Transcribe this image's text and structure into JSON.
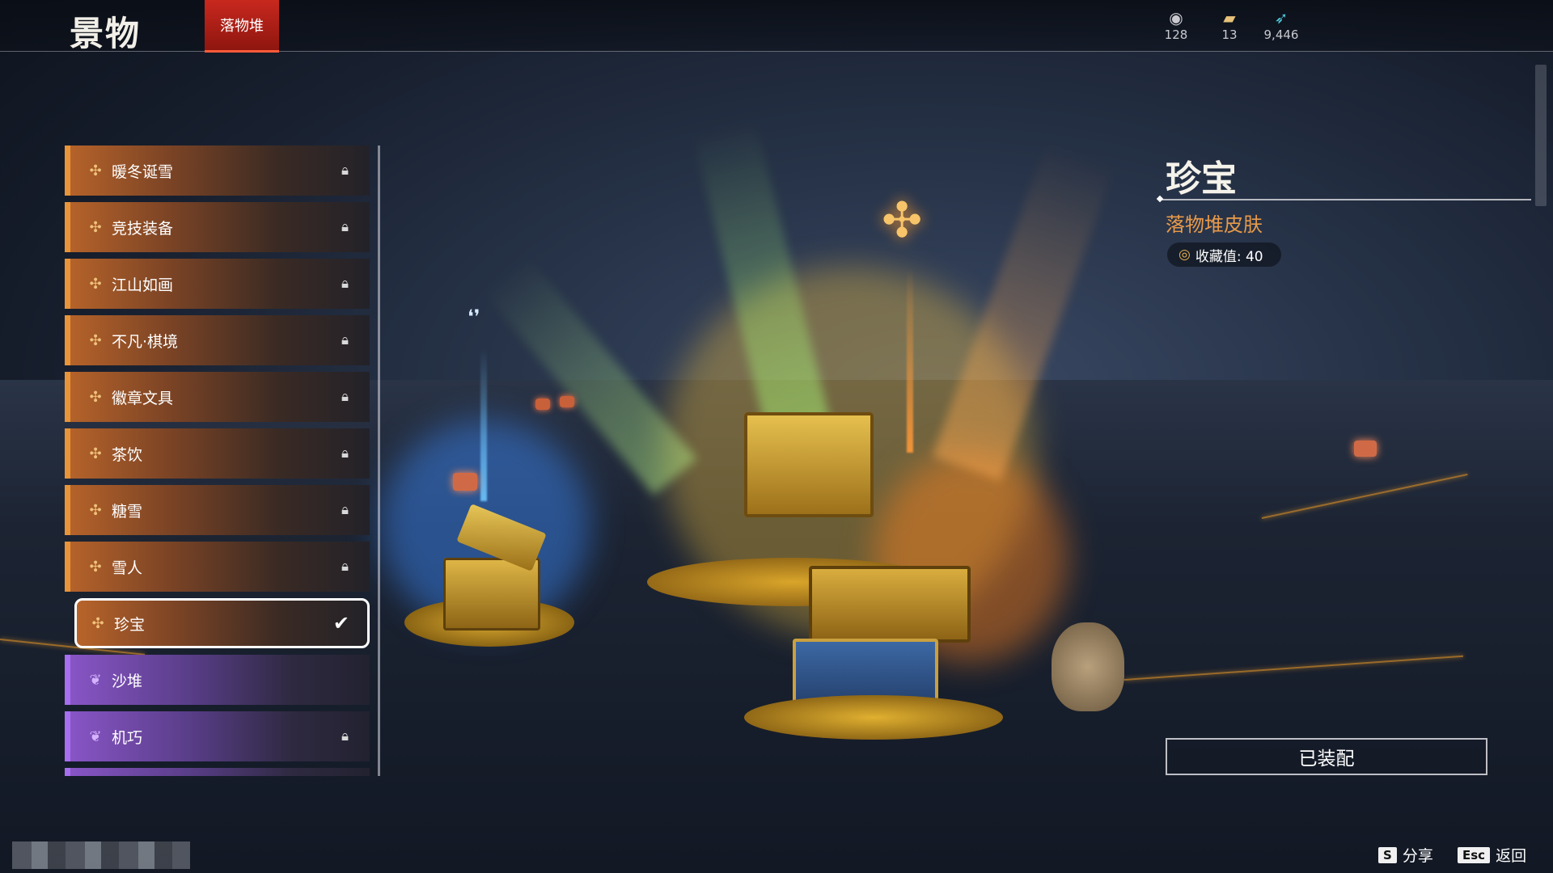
{
  "header": {
    "title": "景物",
    "active_tab": "落物堆",
    "currencies": [
      {
        "icon": "currency-a-icon",
        "value": "128"
      },
      {
        "icon": "ticket-icon",
        "value": "13"
      },
      {
        "icon": "feather-icon",
        "value": "9,446"
      }
    ]
  },
  "list": {
    "items": [
      {
        "label": "暖冬诞雪",
        "rarity": "orange",
        "state": "locked"
      },
      {
        "label": "竞技装备",
        "rarity": "orange",
        "state": "locked"
      },
      {
        "label": "江山如画",
        "rarity": "orange",
        "state": "locked"
      },
      {
        "label": "不凡·棋境",
        "rarity": "orange",
        "state": "locked"
      },
      {
        "label": "徽章文具",
        "rarity": "orange",
        "state": "locked"
      },
      {
        "label": "茶饮",
        "rarity": "orange",
        "state": "locked"
      },
      {
        "label": "糖雪",
        "rarity": "orange",
        "state": "locked"
      },
      {
        "label": "雪人",
        "rarity": "orange",
        "state": "locked"
      },
      {
        "label": "珍宝",
        "rarity": "orange",
        "state": "equipped",
        "selected": true
      },
      {
        "label": "沙堆",
        "rarity": "purple",
        "state": "owned"
      },
      {
        "label": "机巧",
        "rarity": "purple",
        "state": "locked"
      }
    ]
  },
  "detail": {
    "name": "珍宝",
    "type": "落物堆皮肤",
    "collection": "收藏值: 40",
    "equip_button": "已装配"
  },
  "hints": {
    "share_key": "S",
    "share_label": "分享",
    "back_key": "Esc",
    "back_label": "返回"
  },
  "colors": {
    "accent_red": "#c8281e",
    "rarity_orange": "#e8953a",
    "rarity_purple": "#a76ef0",
    "type_text": "#e89a4a"
  }
}
